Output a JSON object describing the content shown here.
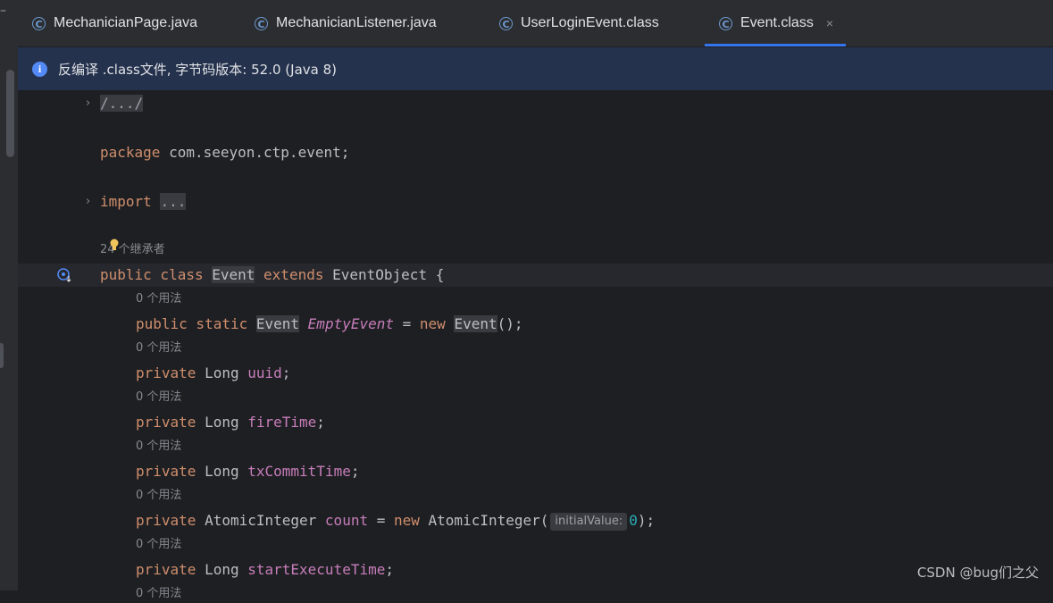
{
  "tabs": [
    {
      "label": "MechanicianPage.java",
      "active": false
    },
    {
      "label": "MechanicianListener.java",
      "active": false
    },
    {
      "label": "UserLoginEvent.class",
      "active": false
    },
    {
      "label": "Event.class",
      "active": true
    }
  ],
  "tab_icon_glyph": "C",
  "close_glyph": "×",
  "banner": {
    "icon": "info-icon",
    "text": "反编译 .class文件, 字节码版本: 52.0 (Java 8)"
  },
  "code": {
    "header_fold": "/.../",
    "package_kw": "package",
    "package_name": " com.seeyon.ctp.event;",
    "import_kw": "import",
    "import_fold": "...",
    "inheritors_hint": "24 个继承者",
    "class_line": {
      "kw1": "public class ",
      "name": "Event",
      "kw2": " extends ",
      "rest": "EventObject {"
    },
    "usage_hint": "0 个用法",
    "fields": [
      {
        "mods": "public static ",
        "type": "Event",
        "name": "EmptyEvent",
        "rest_pre": " = ",
        "new_kw": "new ",
        "ctor": "Event",
        "rest": "();"
      },
      {
        "mods": "private ",
        "type": "Long ",
        "name": "uuid",
        "rest": ";"
      },
      {
        "mods": "private ",
        "type": "Long ",
        "name": "fireTime",
        "rest": ";"
      },
      {
        "mods": "private ",
        "type": "Long ",
        "name": "txCommitTime",
        "rest": ";"
      },
      {
        "mods": "private ",
        "type": "AtomicInteger ",
        "name": "count",
        "rest_pre": " = ",
        "new_kw": "new ",
        "ctor": "AtomicInteger(",
        "inlay": "initialValue:",
        "num": "0",
        "rest": ");"
      },
      {
        "mods": "private ",
        "type": "Long ",
        "name": "startExecuteTime",
        "rest": ";"
      }
    ]
  },
  "watermark": "CSDN @bug们之父",
  "colors": {
    "keyword": "#cf8e6d",
    "field": "#c77dbb",
    "number": "#2aacb8",
    "accent": "#3574f0",
    "banner_bg": "#25324d"
  }
}
